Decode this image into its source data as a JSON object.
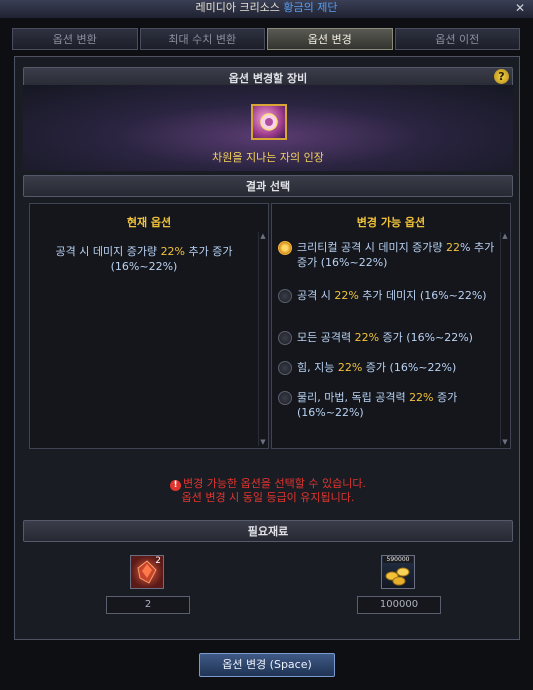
{
  "window": {
    "title_left": "레미디아 크리소스 ",
    "title_mid": "황금의 제단"
  },
  "tabs": [
    {
      "label": "옵션 변환"
    },
    {
      "label": "최대 수치 변환"
    },
    {
      "label": "옵션 변경"
    },
    {
      "label": "옵션 이전"
    }
  ],
  "active_tab_index": 2,
  "equipment": {
    "header": "옵션 변경할 장비",
    "item_name": "차원을 지나는 자의 인장",
    "item_icon": "seal-icon"
  },
  "result": {
    "header": "결과 선택",
    "current": {
      "title": "현재 옵션",
      "text_before": "공격 시 데미지 증가량 ",
      "highlight": "22%",
      "text_after": " 추가 증가 (16%~22%)"
    },
    "changeable": {
      "title": "변경 가능 옵션",
      "selected_index": 0,
      "options": [
        {
          "before": "크리티컬 공격 시 데미지 증가량 ",
          "hl": "22",
          "after": "% 추가 증가 (16%~22%)"
        },
        {
          "before": "공격 시 ",
          "hl": "22%",
          "after": " 추가 데미지 (16%~22%)"
        },
        {
          "before": "모든 공격력 ",
          "hl": "22%",
          "after": " 증가 (16%~22%)"
        },
        {
          "before": "힘, 지능 ",
          "hl": "22%",
          "after": " 증가 (16%~22%)"
        },
        {
          "before": "물리, 마법, 독립 공격력 ",
          "hl": "22%",
          "after": " 증가 (16%~22%)"
        }
      ]
    }
  },
  "notice": {
    "line1": "변경 가능한 옵션을 선택할 수 있습니다.",
    "line2": "옵션 변경 시 동일 등급이 유지됩니다."
  },
  "materials": {
    "header": "필요재료",
    "items": [
      {
        "icon": "red-crystal-icon",
        "badge": "2",
        "quantity": "2"
      },
      {
        "icon": "gold-coins-icon",
        "badge": "590000",
        "quantity": "100000"
      }
    ]
  },
  "action_button": "옵션 변경 (Space)",
  "colors": {
    "highlight": "#f0c23a",
    "notice": "#e0352e",
    "option_text": "#b9d2f2"
  }
}
